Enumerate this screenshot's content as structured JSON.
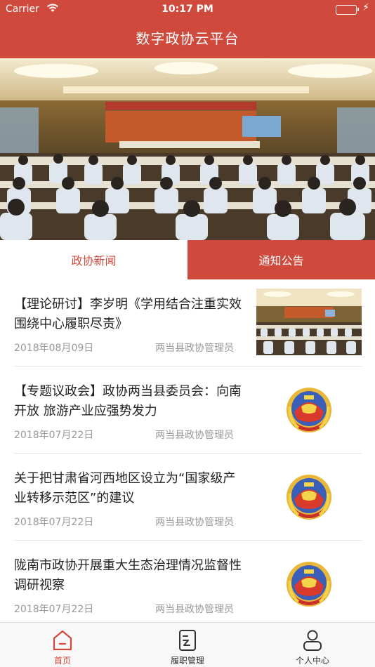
{
  "status_bar": {
    "carrier": "Carrier",
    "time": "10:17 PM"
  },
  "header": {
    "title": "数字政协云平台"
  },
  "tabs": [
    {
      "label": "政协新闻",
      "active": true
    },
    {
      "label": "通知公告",
      "active": false
    }
  ],
  "news": [
    {
      "title": "【理论研讨】李岁明《学用结合注重实效 围绕中心履职尽责》",
      "date": "2018年08月09日",
      "author": "两当县政协管理员",
      "thumb": "meeting-photo"
    },
    {
      "title": "【专题议政会】政协两当县委员会：向南开放 旅游产业应强势发力",
      "date": "2018年07月22日",
      "author": "两当县政协管理员",
      "thumb": "cppcc-emblem"
    },
    {
      "title": "关于把甘肃省河西地区设立为“国家级产业转移示范区”的建议",
      "date": "2018年07月22日",
      "author": "两当县政协管理员",
      "thumb": "cppcc-emblem"
    },
    {
      "title": "陇南市政协开展重大生态治理情况监督性调研视察",
      "date": "2018年07月22日",
      "author": "两当县政协管理员",
      "thumb": "cppcc-emblem"
    }
  ],
  "tabbar": [
    {
      "label": "首页",
      "icon": "home-icon",
      "active": true
    },
    {
      "label": "履职管理",
      "icon": "document-icon",
      "active": false
    },
    {
      "label": "个人中心",
      "icon": "user-icon",
      "active": false
    }
  ],
  "colors": {
    "accent": "#cf4a3d",
    "text": "#222222",
    "meta": "#999999"
  }
}
